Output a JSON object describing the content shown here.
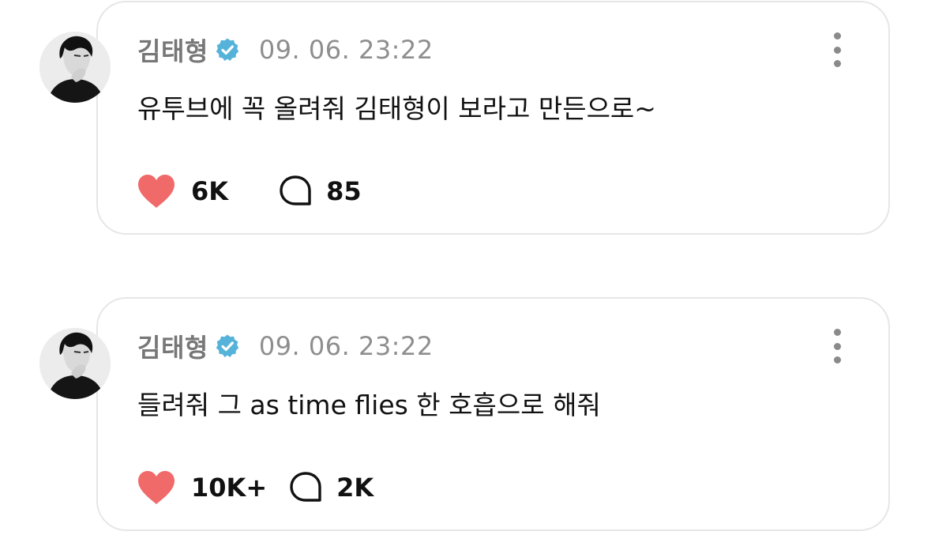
{
  "colors": {
    "heart": "#f06a6a",
    "verified_badge": "#55b3d9",
    "card_border": "#e6e6e9",
    "meta_text": "#8e8e8e"
  },
  "posts": [
    {
      "username": "김태형",
      "verified_icon": "verified-badge-icon",
      "timestamp": "09. 06. 23:22",
      "message": "유투브에 꼭 올려줘 김태형이 보라고 만든으로~",
      "likes": "6K",
      "comments": "85"
    },
    {
      "username": "김태형",
      "verified_icon": "verified-badge-icon",
      "timestamp": "09. 06. 23:22",
      "message": "들려줘 그 as time flies 한 호흡으로 해줘",
      "likes": "10K+",
      "comments": "2K"
    }
  ]
}
